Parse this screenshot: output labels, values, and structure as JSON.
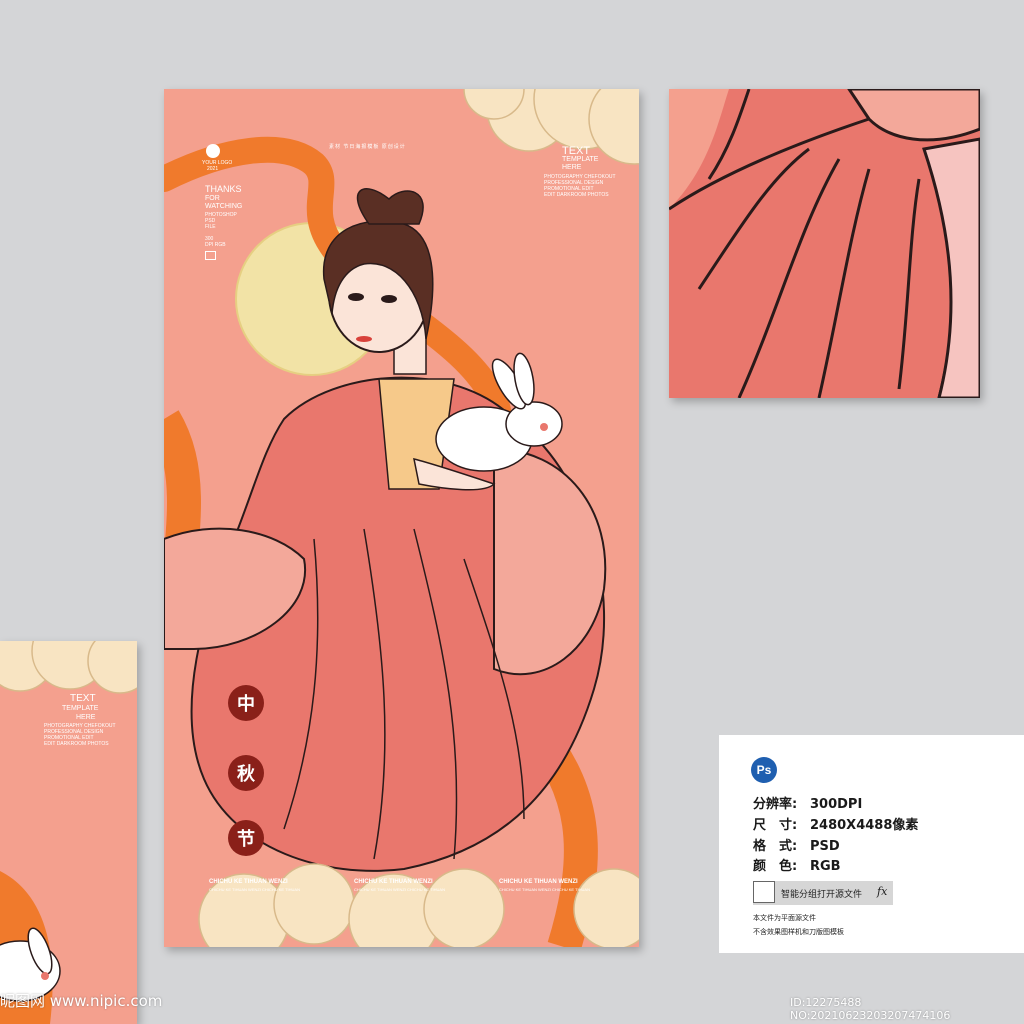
{
  "poster": {
    "logo_text": "YOUR LOGO",
    "year": "2021",
    "thanks": "THANKS",
    "for_text": "FOR",
    "watching": "WATCHING",
    "photoshop": "PHOTOSHOP",
    "psd": "PSD",
    "file": "FILE",
    "dpi_num": "300",
    "dpi_rgb": "DPI RGB",
    "top_center": "素材 节日海报模板 原创设计",
    "text_label": "TEXT",
    "template": "TEMPLATE",
    "here": "HERE",
    "right_small_1": "PHOTOGRAPHY CHEFOKOUT",
    "right_small_2": "PROFESSIONAL DESIGN",
    "right_small_3": "PROMOTIONAL EDIT",
    "right_small_4": "EDIT DARKROOM PHOTOS",
    "seal_1": "中",
    "seal_2": "秋",
    "seal_3": "节",
    "bottom_label": "CHICHU KE TIHUAN WENZI",
    "bottom_sub": "CHICHU KE TIHUAN WENZI CHICHU KE TIHUAN"
  },
  "poster2": {
    "text_label": "TEXT",
    "template": "TEMPLATE",
    "here": "HERE",
    "right_small_1": "PHOTOGRAPHY CHEFOKOUT",
    "right_small_2": "PROFESSIONAL DESIGN",
    "right_small_3": "PROMOTIONAL EDIT",
    "right_small_4": "EDIT DARKROOM PHOTOS"
  },
  "info": {
    "ps_badge": "Ps",
    "rows": [
      {
        "key": "分辨率:",
        "value": "300DPI"
      },
      {
        "key": "尺　寸:",
        "value": "2480X4488像素"
      },
      {
        "key": "格　式:",
        "value": "PSD"
      },
      {
        "key": "颜　色:",
        "value": "RGB"
      }
    ],
    "layer_text": "智能分组打开源文件",
    "fx": "fx",
    "note_1": "本文件为平面源文件",
    "note_2": "不含效果图样机和刀版图模板"
  },
  "footer": {
    "watermark": "昵图网 www.nipic.com",
    "id_text": "ID:12275488 NO:20210623203207474106"
  },
  "colors": {
    "background": "#d4d5d7",
    "poster_pink": "#f4a08e",
    "robe_pink": "#e9776d",
    "ribbon_orange": "#f07a2c",
    "moon": "#f2e3a6",
    "seal_red": "#8a2019",
    "cloud": "#f8e4c2"
  }
}
